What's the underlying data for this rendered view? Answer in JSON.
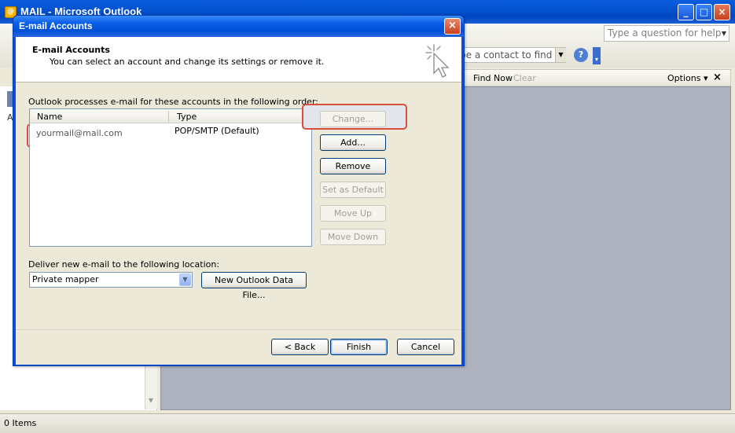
{
  "main_window": {
    "title": "MAIL - Microsoft Outlook",
    "help_placeholder": "Type a question for help",
    "contact_placeholder": "pe a contact to find",
    "find_now": "Find Now",
    "clear": "Clear",
    "options": "Options ▾",
    "find_close": "×",
    "left_label": "A",
    "status": "0 Items",
    "controls": {
      "minimize": "_",
      "maximize": "□",
      "close": "×"
    }
  },
  "dialog": {
    "title": "E-mail Accounts",
    "close": "×",
    "header": {
      "title": "E-mail Accounts",
      "subtitle": "You can select an account and change its settings or remove it."
    },
    "accounts_label": "Outlook processes e-mail for these accounts in the following order:",
    "columns": {
      "name": "Name",
      "type": "Type"
    },
    "accounts": [
      {
        "name": "yourmail@mail.com",
        "type": "POP/SMTP (Default)"
      }
    ],
    "buttons": {
      "change": "Change...",
      "add": "Add...",
      "remove": "Remove",
      "set_default": "Set as Default",
      "move_up": "Move Up",
      "move_down": "Move Down",
      "new_data_file": "New Outlook Data File...",
      "back": "< Back",
      "finish": "Finish",
      "cancel": "Cancel"
    },
    "deliver_label": "Deliver new e-mail to the following location:",
    "deliver_value": "Private mapper"
  },
  "colors": {
    "highlight_border": "#d94d3b",
    "titlebar_blue": "#0a5ee8",
    "dialog_face": "#ece9d8"
  }
}
